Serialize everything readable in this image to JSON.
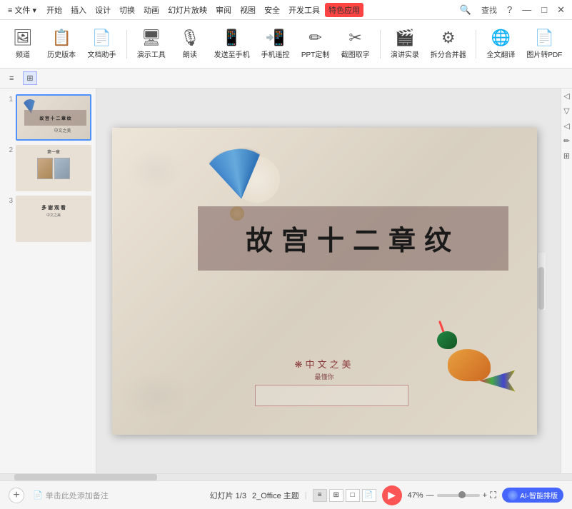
{
  "titlebar": {
    "menu_items": [
      "文件",
      "开始",
      "插入",
      "设计",
      "切换",
      "动画",
      "幻灯片放映",
      "审阅",
      "视图",
      "安全",
      "开发工具",
      "特色应用"
    ],
    "search": "查找",
    "special_label": "特色应用"
  },
  "toolbar": {
    "items": [
      {
        "label": "频道",
        "icon": "🖼"
      },
      {
        "label": "历史版本",
        "icon": "📋"
      },
      {
        "label": "文档助手",
        "icon": "📄"
      },
      {
        "label": "演示工具",
        "icon": "🖥"
      },
      {
        "label": "朗读",
        "icon": "🎙"
      },
      {
        "label": "发送至手机",
        "icon": "📱"
      },
      {
        "label": "手机遥控",
        "icon": "📲"
      },
      {
        "label": "PPT定制",
        "icon": "✏"
      },
      {
        "label": "截图取字",
        "icon": "✂"
      },
      {
        "label": "演讲实录",
        "icon": "🎬"
      },
      {
        "label": "拆分合并器",
        "icon": "⚙"
      },
      {
        "label": "全文翻译",
        "icon": "🌐"
      },
      {
        "label": "图片转PDF",
        "icon": "📄"
      }
    ]
  },
  "secondary_toolbar": {
    "list_btn": "≡",
    "grid_btn": "⊞"
  },
  "slides": [
    {
      "num": "1",
      "active": true
    },
    {
      "num": "2",
      "active": false
    },
    {
      "num": "3",
      "active": false
    }
  ],
  "slide_main": {
    "title": "故宫十二章纹",
    "subtitle": "❋中文之美",
    "subtitle_small": "最懂你",
    "theme": "2_Office 主题"
  },
  "status": {
    "add_btn": "+",
    "note_icon": "📄",
    "note_text": "单击此处添加备注",
    "slide_info": "幻灯片 1/3",
    "theme": "2_Office 主题",
    "zoom": "47%",
    "ai_label": "AI-智能排版",
    "play_icon": "▶"
  }
}
